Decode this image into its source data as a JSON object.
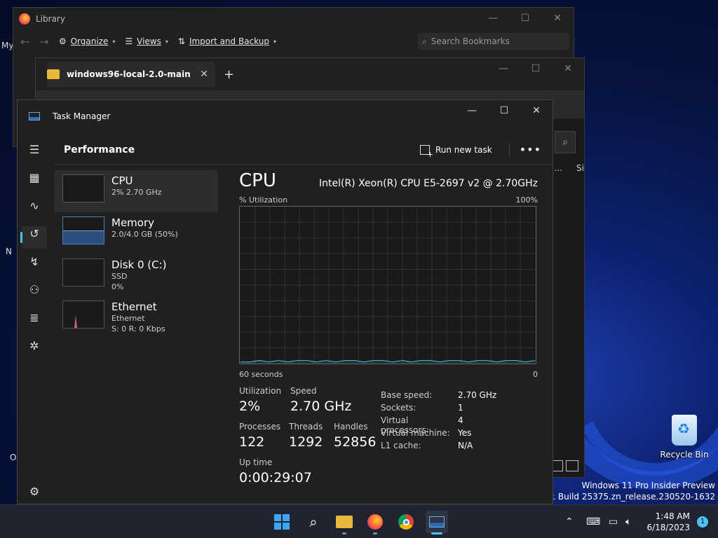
{
  "desktop": {
    "recycle_bin_label": "Recycle Bin",
    "left_fragments": [
      "My",
      "N",
      "O"
    ],
    "watermark_line1": "Windows 11 Pro Insider Preview",
    "watermark_line2": "on copy. Build 25375.zn_release.230520-1632"
  },
  "library": {
    "title": "Library",
    "organize": "Organize",
    "views": "Views",
    "import_backup": "Import and Backup",
    "search_placeholder": "Search Bookmarks"
  },
  "explorer": {
    "tab_title": "windows96-local-2.0-main",
    "column_fragments": [
      "d ...",
      "Si"
    ]
  },
  "taskmanager": {
    "title": "Task Manager",
    "page_title": "Performance",
    "run_new_task": "Run new task",
    "resources": [
      {
        "name": "CPU",
        "sub1": "2% 2.70 GHz",
        "sub2": ""
      },
      {
        "name": "Memory",
        "sub1": "2.0/4.0 GB (50%)",
        "sub2": ""
      },
      {
        "name": "Disk 0 (C:)",
        "sub1": "SSD",
        "sub2": "0%"
      },
      {
        "name": "Ethernet",
        "sub1": "Ethernet",
        "sub2": "S: 0 R: 0 Kbps"
      }
    ],
    "memory_fill_fraction": 0.5,
    "detail": {
      "heading": "CPU",
      "model": "Intel(R) Xeon(R) CPU E5-2697 v2 @ 2.70GHz",
      "util_label": "% Utilization",
      "max_label": "100%",
      "time_label": "60 seconds",
      "min_label": "0",
      "utilization_label": "Utilization",
      "utilization": "2%",
      "speed_label": "Speed",
      "speed": "2.70 GHz",
      "processes_label": "Processes",
      "processes": "122",
      "threads_label": "Threads",
      "threads": "1292",
      "handles_label": "Handles",
      "handles": "52856",
      "uptime_label": "Up time",
      "uptime": "0:00:29:07",
      "specs": [
        {
          "k": "Base speed:",
          "v": "2.70 GHz"
        },
        {
          "k": "Sockets:",
          "v": "1"
        },
        {
          "k": "Virtual processors:",
          "v": "4"
        },
        {
          "k": "Virtual machine:",
          "v": "Yes"
        },
        {
          "k": "L1 cache:",
          "v": "N/A"
        }
      ]
    }
  },
  "chart_data": {
    "type": "line",
    "title": "",
    "xlabel": "60 seconds",
    "ylabel": "% Utilization",
    "ylim": [
      0,
      100
    ],
    "series": [
      {
        "values": [
          1,
          1,
          2,
          1,
          2,
          1,
          2,
          2,
          1,
          2,
          1,
          2,
          2,
          1,
          2,
          2,
          1,
          2,
          1,
          2,
          2,
          1,
          2,
          2,
          1,
          2,
          2,
          1,
          2,
          2,
          1,
          2
        ]
      }
    ]
  },
  "taskbar": {
    "time": "1:48 AM",
    "date": "6/18/2023",
    "notification_count": "1"
  },
  "colors": {
    "accent": "#4cc2ff",
    "cpu_line": "#3fb0c8",
    "memory": "#4b7db9",
    "ethernet": "#d45a8c"
  }
}
